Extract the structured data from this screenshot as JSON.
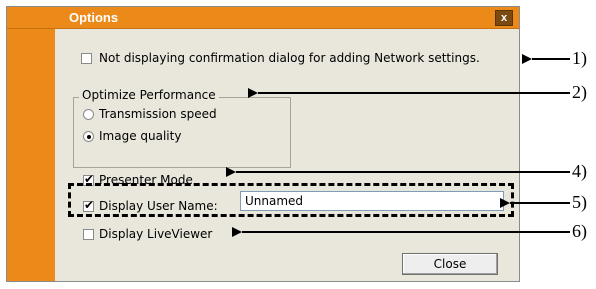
{
  "dialog": {
    "title": "Options",
    "close_glyph": "x"
  },
  "options": {
    "network_confirm": {
      "label": "Not displaying confirmation dialog for adding Network settings.",
      "checked": false
    },
    "optimize_group": {
      "label": "Optimize Performance",
      "radios": [
        {
          "label": "Transmission speed",
          "selected": false
        },
        {
          "label": "Image quality",
          "selected": true
        }
      ]
    },
    "presenter_mode": {
      "label": "Presenter Mode",
      "checked": true
    },
    "display_user_name": {
      "label": "Display User Name:",
      "checked": true,
      "value": "Unnamed"
    },
    "display_liveviewer": {
      "label": "Display LiveViewer",
      "checked": false
    },
    "close_button": "Close"
  },
  "callouts": [
    "1)",
    "2)",
    "4)",
    "5)",
    "6)"
  ],
  "colors": {
    "accent": "#ec8a19",
    "panel": "#e9e6dc"
  },
  "check_glyph": "✔"
}
